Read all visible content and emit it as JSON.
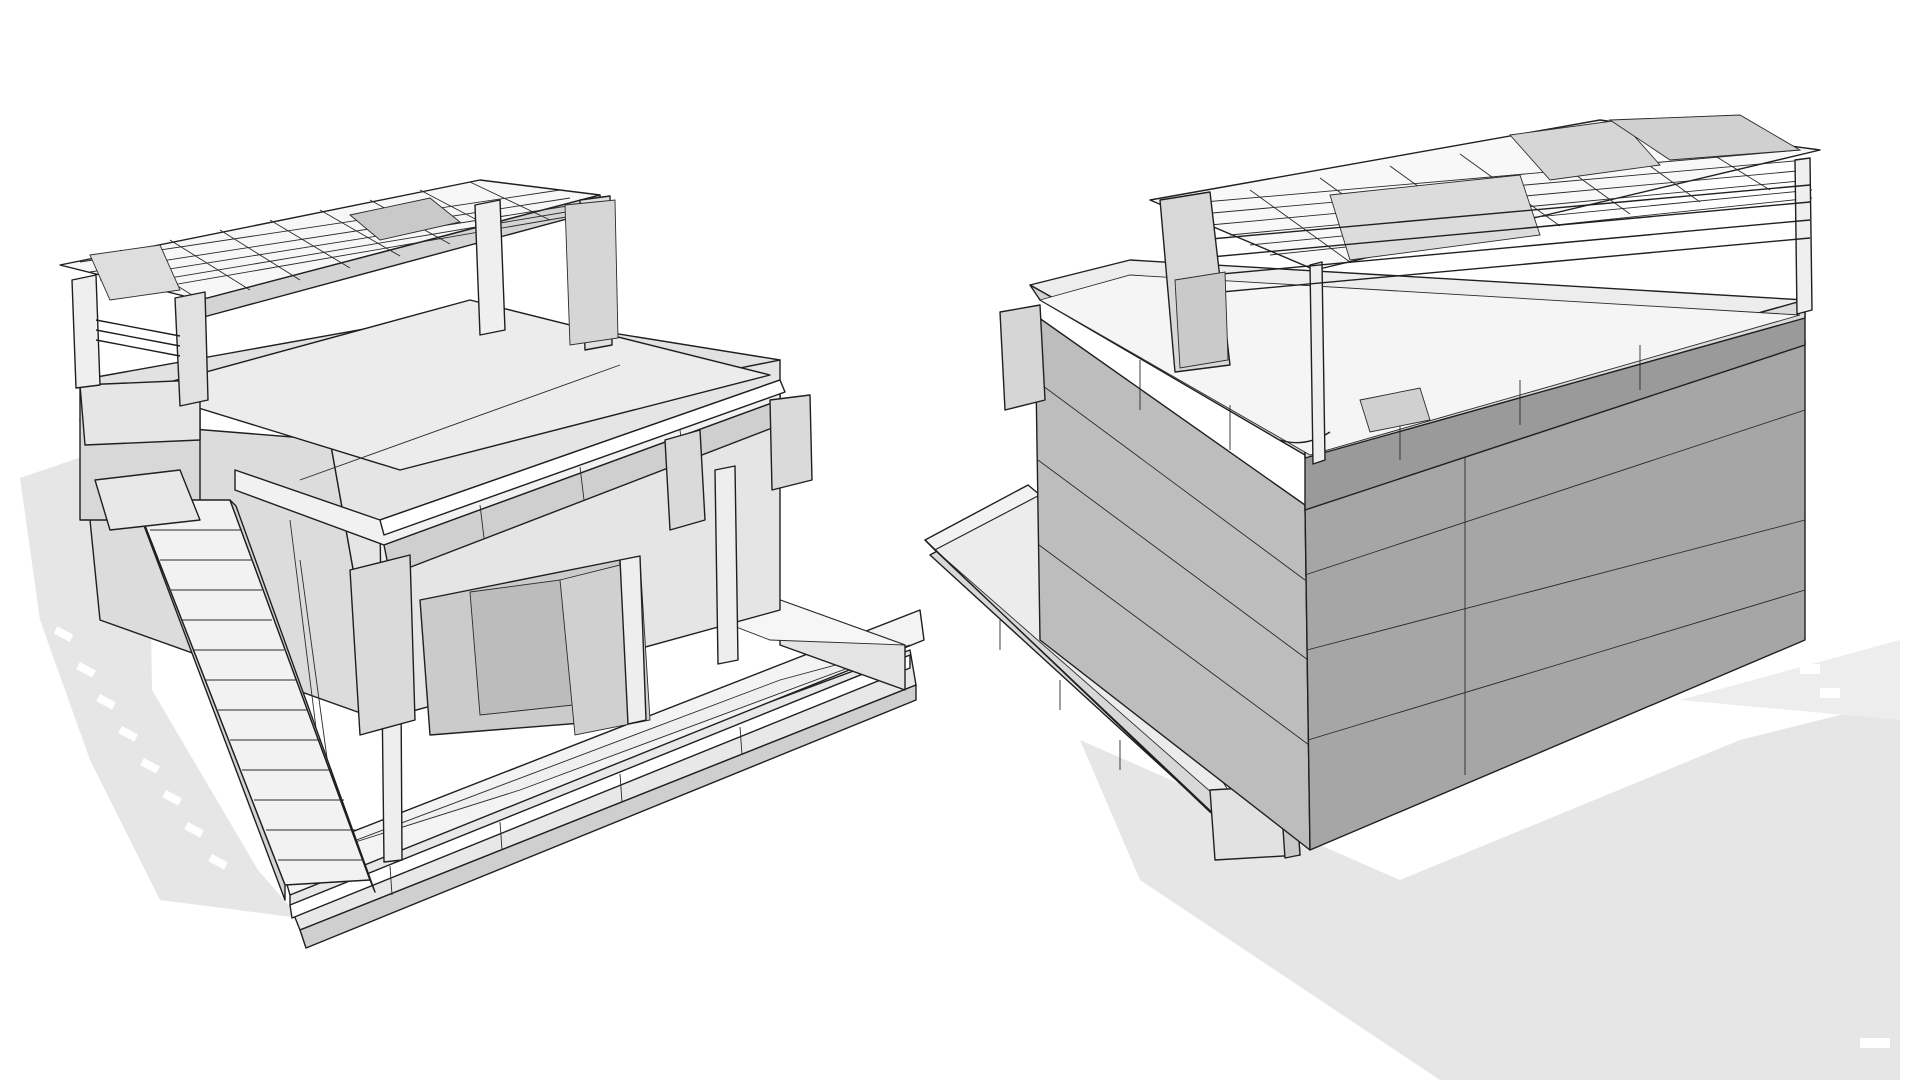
{
  "scene": {
    "background": "#ffffff",
    "line_color": "#1f1f1f",
    "surface_light": "#eeeeee",
    "surface_mid": "#d2d2d2",
    "surface_dark": "#9a9a9a",
    "shadow_color": "#e6e6e6"
  },
  "views": [
    {
      "view": "front-staircase"
    },
    {
      "view": "rear-clad-wall"
    }
  ]
}
